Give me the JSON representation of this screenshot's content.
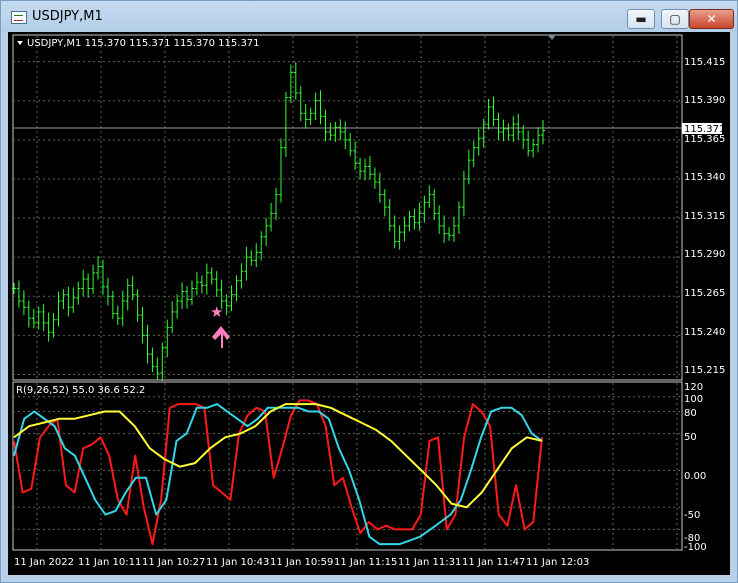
{
  "window": {
    "title": "USDJPY,M1",
    "buttons": {
      "minimize": "▬",
      "maximize": "▢",
      "close": "✕"
    }
  },
  "chart": {
    "symbol_header": "USDJPY,M1  115.370 115.371 115.370 115.371",
    "current_price_label": "115.371",
    "price_axis": [
      "115.415",
      "115.390",
      "115.365",
      "115.340",
      "115.315",
      "115.290",
      "115.265",
      "115.240",
      "115.215"
    ],
    "signal": {
      "star": "★",
      "arrow": "buy-arrow"
    },
    "colors": {
      "bull": "#33ff33",
      "bg": "#000000",
      "grid": "#6a7a6a"
    }
  },
  "indicator": {
    "header": "R(9,26,52) 55.0 36.6 52.2",
    "axis": [
      "120",
      "100",
      "80",
      "50",
      "0.00",
      "-50",
      "-80",
      "-100"
    ],
    "colors": {
      "fast": "#ff1a1a",
      "mid": "#33d6e6",
      "slow": "#ffff33"
    }
  },
  "time_axis": [
    "11 Jan 2022",
    "11 Jan 10:11",
    "11 Jan 10:27",
    "11 Jan 10:43",
    "11 Jan 10:59",
    "11 Jan 11:15",
    "11 Jan 11:31",
    "11 Jan 11:47",
    "11 Jan 12:03"
  ],
  "chart_data": {
    "type": "line",
    "title": "USDJPY,M1",
    "price_series": [
      115.27,
      115.262,
      115.258,
      115.251,
      115.248,
      115.255,
      115.248,
      115.242,
      115.25,
      115.262,
      115.266,
      115.258,
      115.264,
      115.27,
      115.276,
      115.27,
      115.28,
      115.284,
      115.271,
      115.265,
      115.254,
      115.251,
      115.262,
      115.272,
      115.266,
      115.253,
      115.24,
      115.228,
      115.22,
      115.216,
      115.232,
      115.245,
      115.255,
      115.262,
      115.268,
      115.263,
      115.27,
      115.274,
      115.272,
      115.28,
      115.276,
      115.269,
      115.262,
      115.259,
      115.266,
      115.275,
      115.281,
      115.29,
      115.288,
      115.293,
      115.303,
      115.31,
      115.318,
      115.33,
      115.36,
      115.392,
      115.408,
      115.395,
      115.382,
      115.378,
      115.382,
      115.39,
      115.38,
      115.37,
      115.368,
      115.373,
      115.37,
      115.365,
      115.358,
      115.35,
      115.345,
      115.348,
      115.343,
      115.338,
      115.33,
      115.322,
      115.31,
      115.3,
      115.306,
      115.31,
      115.316,
      115.312,
      115.318,
      115.325,
      115.33,
      115.318,
      115.31,
      115.305,
      115.304,
      115.31,
      115.322,
      115.34,
      115.352,
      115.36,
      115.366,
      115.375,
      115.386,
      115.378,
      115.37,
      115.372,
      115.368,
      115.375,
      115.37,
      115.365,
      115.358,
      115.362,
      115.368,
      115.371
    ],
    "indicator_series": [
      {
        "name": "55.0",
        "values": [
          40,
          -30,
          -25,
          45,
          60,
          70,
          -20,
          -30,
          30,
          35,
          45,
          20,
          -40,
          -60,
          20,
          -50,
          -100,
          -40,
          85,
          90,
          90,
          90,
          85,
          -20,
          -30,
          -40,
          50,
          75,
          85,
          80,
          -10,
          30,
          75,
          95,
          95,
          90,
          60,
          -20,
          -10,
          -50,
          -85,
          -70,
          -80,
          -75,
          -80,
          -80,
          -80,
          -60,
          40,
          45,
          -80,
          -60,
          45,
          90,
          80,
          60,
          -60,
          -75,
          -20,
          -80,
          -70,
          45
        ]
      },
      {
        "name": "36.6",
        "values": [
          20,
          70,
          80,
          70,
          60,
          30,
          20,
          -10,
          -40,
          -60,
          -55,
          -30,
          -10,
          -10,
          -60,
          -40,
          40,
          50,
          85,
          85,
          90,
          80,
          70,
          60,
          70,
          85,
          85,
          85,
          85,
          80,
          80,
          70,
          30,
          0,
          -40,
          -90,
          -100,
          -100,
          -100,
          -95,
          -90,
          -80,
          -70,
          -60,
          -40,
          0,
          45,
          80,
          85,
          85,
          75,
          50,
          40
        ]
      },
      {
        "name": "52.2",
        "values": [
          45,
          60,
          65,
          70,
          70,
          75,
          80,
          80,
          60,
          30,
          15,
          5,
          10,
          30,
          45,
          50,
          60,
          80,
          90,
          90,
          90,
          85,
          75,
          65,
          55,
          40,
          20,
          0,
          -20,
          -45,
          -50,
          -30,
          0,
          30,
          45,
          40
        ]
      }
    ],
    "x_labels": [
      "11 Jan 2022",
      "11 Jan 10:11",
      "11 Jan 10:27",
      "11 Jan 10:43",
      "11 Jan 10:59",
      "11 Jan 11:15",
      "11 Jan 11:31",
      "11 Jan 11:47",
      "11 Jan 12:03"
    ],
    "ylim": [
      115.2115,
      115.432
    ],
    "indicator_ylim": [
      -108,
      120
    ]
  }
}
